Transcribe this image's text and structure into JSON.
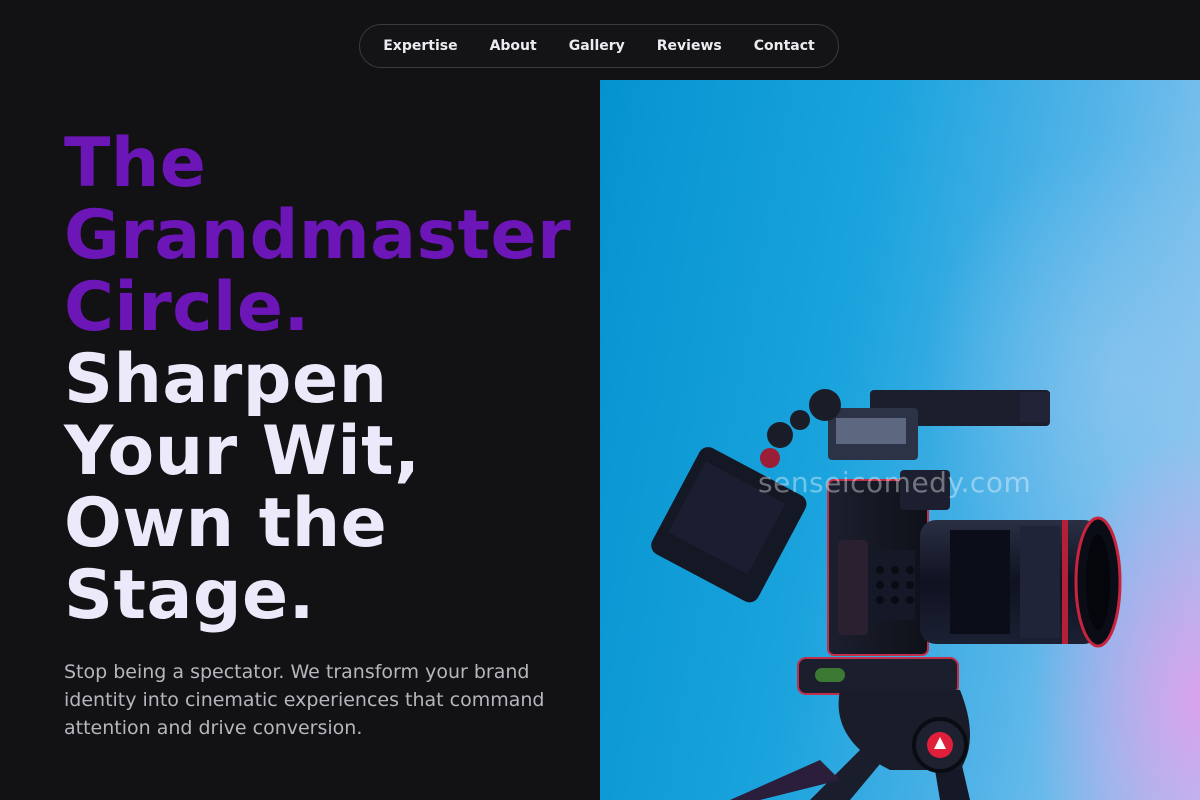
{
  "nav": {
    "items": [
      "Expertise",
      "About",
      "Gallery",
      "Reviews",
      "Contact"
    ]
  },
  "hero": {
    "headline_accent": [
      "The",
      "Grandmaster",
      "Circle."
    ],
    "headline_main": [
      "Sharpen",
      "Your Wit,",
      "Own the",
      "Stage."
    ],
    "lede": "Stop being a spectator. We transform your brand identity into cinematic experiences that command attention and drive conversion.",
    "image_watermark": "senseicomedy.com",
    "image_subject": "cinema camera on tripod against blue backdrop"
  },
  "colors": {
    "background": "#121113",
    "accent": "#6c16b8",
    "headline": "#ece9fa",
    "body_text": "#b7b5bd",
    "nav_border": "#3b3a3f"
  }
}
